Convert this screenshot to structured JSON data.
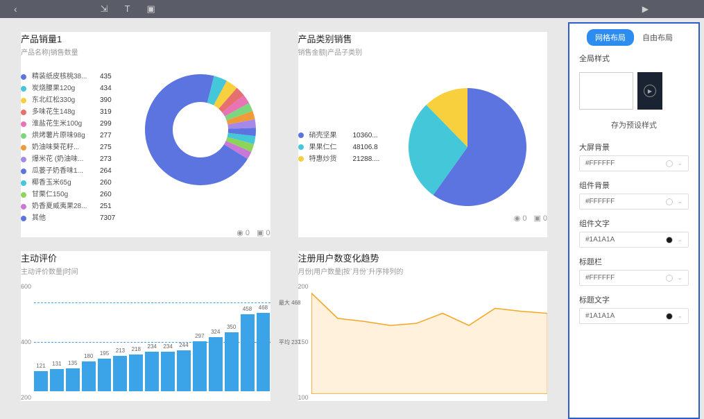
{
  "topbar": {
    "back_icon": "‹"
  },
  "rightpanel": {
    "tab_grid": "网格布局",
    "tab_free": "自由布局",
    "global_style": "全局样式",
    "save_preset": "存为预设样式",
    "fields": {
      "bg_screen": {
        "label": "大屏背景",
        "value": "#FFFFFF",
        "dot": "#FFFFFF"
      },
      "bg_widget": {
        "label": "组件背景",
        "value": "#FFFFFF",
        "dot": "#FFFFFF"
      },
      "text_widget": {
        "label": "组件文字",
        "value": "#1A1A1A",
        "dot": "#1A1A1A"
      },
      "titlebar": {
        "label": "标题栏",
        "value": "#FFFFFF",
        "dot": "#FFFFFF"
      },
      "title_text": {
        "label": "标题文字",
        "value": "#1A1A1A",
        "dot": "#1A1A1A"
      }
    }
  },
  "widget_toolbar": {
    "views_icon": "◉",
    "views": "0",
    "comments_icon": "▣",
    "comments": "0"
  },
  "widgets": {
    "donut": {
      "title": "产品销量1",
      "subtitle": "产品名称|销售数量",
      "legend": [
        {
          "label": "精装纸皮核桃38...",
          "value": 435,
          "color": "#5b74e0"
        },
        {
          "label": "炭烧腰果120g",
          "value": 434,
          "color": "#45c7da"
        },
        {
          "label": "东北红松330g",
          "value": 390,
          "color": "#f8cf3d"
        },
        {
          "label": "多味花生148g",
          "value": 319,
          "color": "#e66f6f"
        },
        {
          "label": "淮盐花生米100g",
          "value": 299,
          "color": "#e874b6"
        },
        {
          "label": "烘烤薯片原味98g",
          "value": 277,
          "color": "#7bd680"
        },
        {
          "label": "奶油味葵花籽...",
          "value": 275,
          "color": "#f09b3a"
        },
        {
          "label": "爆米花 (奶油味...",
          "value": 273,
          "color": "#a688e8"
        },
        {
          "label": "瓜蒌子奶香味1...",
          "value": 264,
          "color": "#5b74e0"
        },
        {
          "label": "椰香玉米65g",
          "value": 260,
          "color": "#45c7da"
        },
        {
          "label": "甘栗仁150g",
          "value": 260,
          "color": "#8fd45a"
        },
        {
          "label": "奶香夏威夷果28...",
          "value": 251,
          "color": "#c978d8"
        },
        {
          "label": "其他",
          "value": 7307,
          "color": "#5b74e0"
        }
      ]
    },
    "pie": {
      "title": "产品类别销售",
      "subtitle": "销售金额|产品子类别",
      "legend": [
        {
          "label": "硝壳坚果",
          "value": "10360...",
          "color": "#5b74e0"
        },
        {
          "label": "果果仁仁",
          "value": "48106.8",
          "color": "#45c7da"
        },
        {
          "label": "特惠炒货",
          "value": "21288....",
          "color": "#f8cf3d"
        }
      ]
    },
    "bar": {
      "title": "主动评价",
      "subtitle": "主动评价数量|时间",
      "y_ticks": [
        "600",
        "400",
        "200"
      ],
      "max_label": "最大 468",
      "avg_label": "平均 237",
      "values": [
        121,
        131,
        135,
        180,
        195,
        213,
        218,
        234,
        234,
        244,
        297,
        324,
        350,
        458,
        468
      ]
    },
    "area": {
      "title": "注册用户数变化趋势",
      "subtitle": "月份|用户数量|按`月份`升序排列的",
      "y_ticks": [
        "200",
        "150",
        "100"
      ],
      "points": [
        200,
        175,
        172,
        168,
        170,
        180,
        168,
        185,
        182,
        180
      ]
    }
  },
  "chart_data": [
    {
      "type": "pie",
      "title": "产品销量1",
      "subtitle": "产品名称|销售数量",
      "series": [
        {
          "name": "销售数量",
          "values": [
            435,
            434,
            390,
            319,
            299,
            277,
            275,
            273,
            264,
            260,
            260,
            251,
            7307
          ]
        }
      ],
      "categories": [
        "精装纸皮核桃38...",
        "炭烧腰果120g",
        "东北红松330g",
        "多味花生148g",
        "淮盐花生米100g",
        "烘烤薯片原味98g",
        "奶油味葵花籽...",
        "爆米花 (奶油味...",
        "瓜蒌子奶香味1...",
        "椰香玉米65g",
        "甘栗仁150g",
        "奶香夏威夷果28...",
        "其他"
      ],
      "donut": true
    },
    {
      "type": "pie",
      "title": "产品类别销售",
      "subtitle": "销售金额|产品子类别",
      "categories": [
        "硝壳坚果",
        "果果仁仁",
        "特惠炒货"
      ],
      "series": [
        {
          "name": "销售金额",
          "values": [
            103600,
            48106.8,
            21288
          ]
        }
      ]
    },
    {
      "type": "bar",
      "title": "主动评价",
      "xlabel": "时间",
      "ylabel": "主动评价数量",
      "ylim": [
        0,
        600
      ],
      "values": [
        121,
        131,
        135,
        180,
        195,
        213,
        218,
        234,
        234,
        244,
        297,
        324,
        350,
        458,
        468
      ],
      "annotations": {
        "max": 468,
        "avg": 237
      }
    },
    {
      "type": "area",
      "title": "注册用户数变化趋势",
      "xlabel": "月份",
      "ylabel": "用户数量",
      "ylim": [
        100,
        200
      ],
      "values": [
        200,
        175,
        172,
        168,
        170,
        180,
        168,
        185,
        182,
        180
      ]
    }
  ]
}
